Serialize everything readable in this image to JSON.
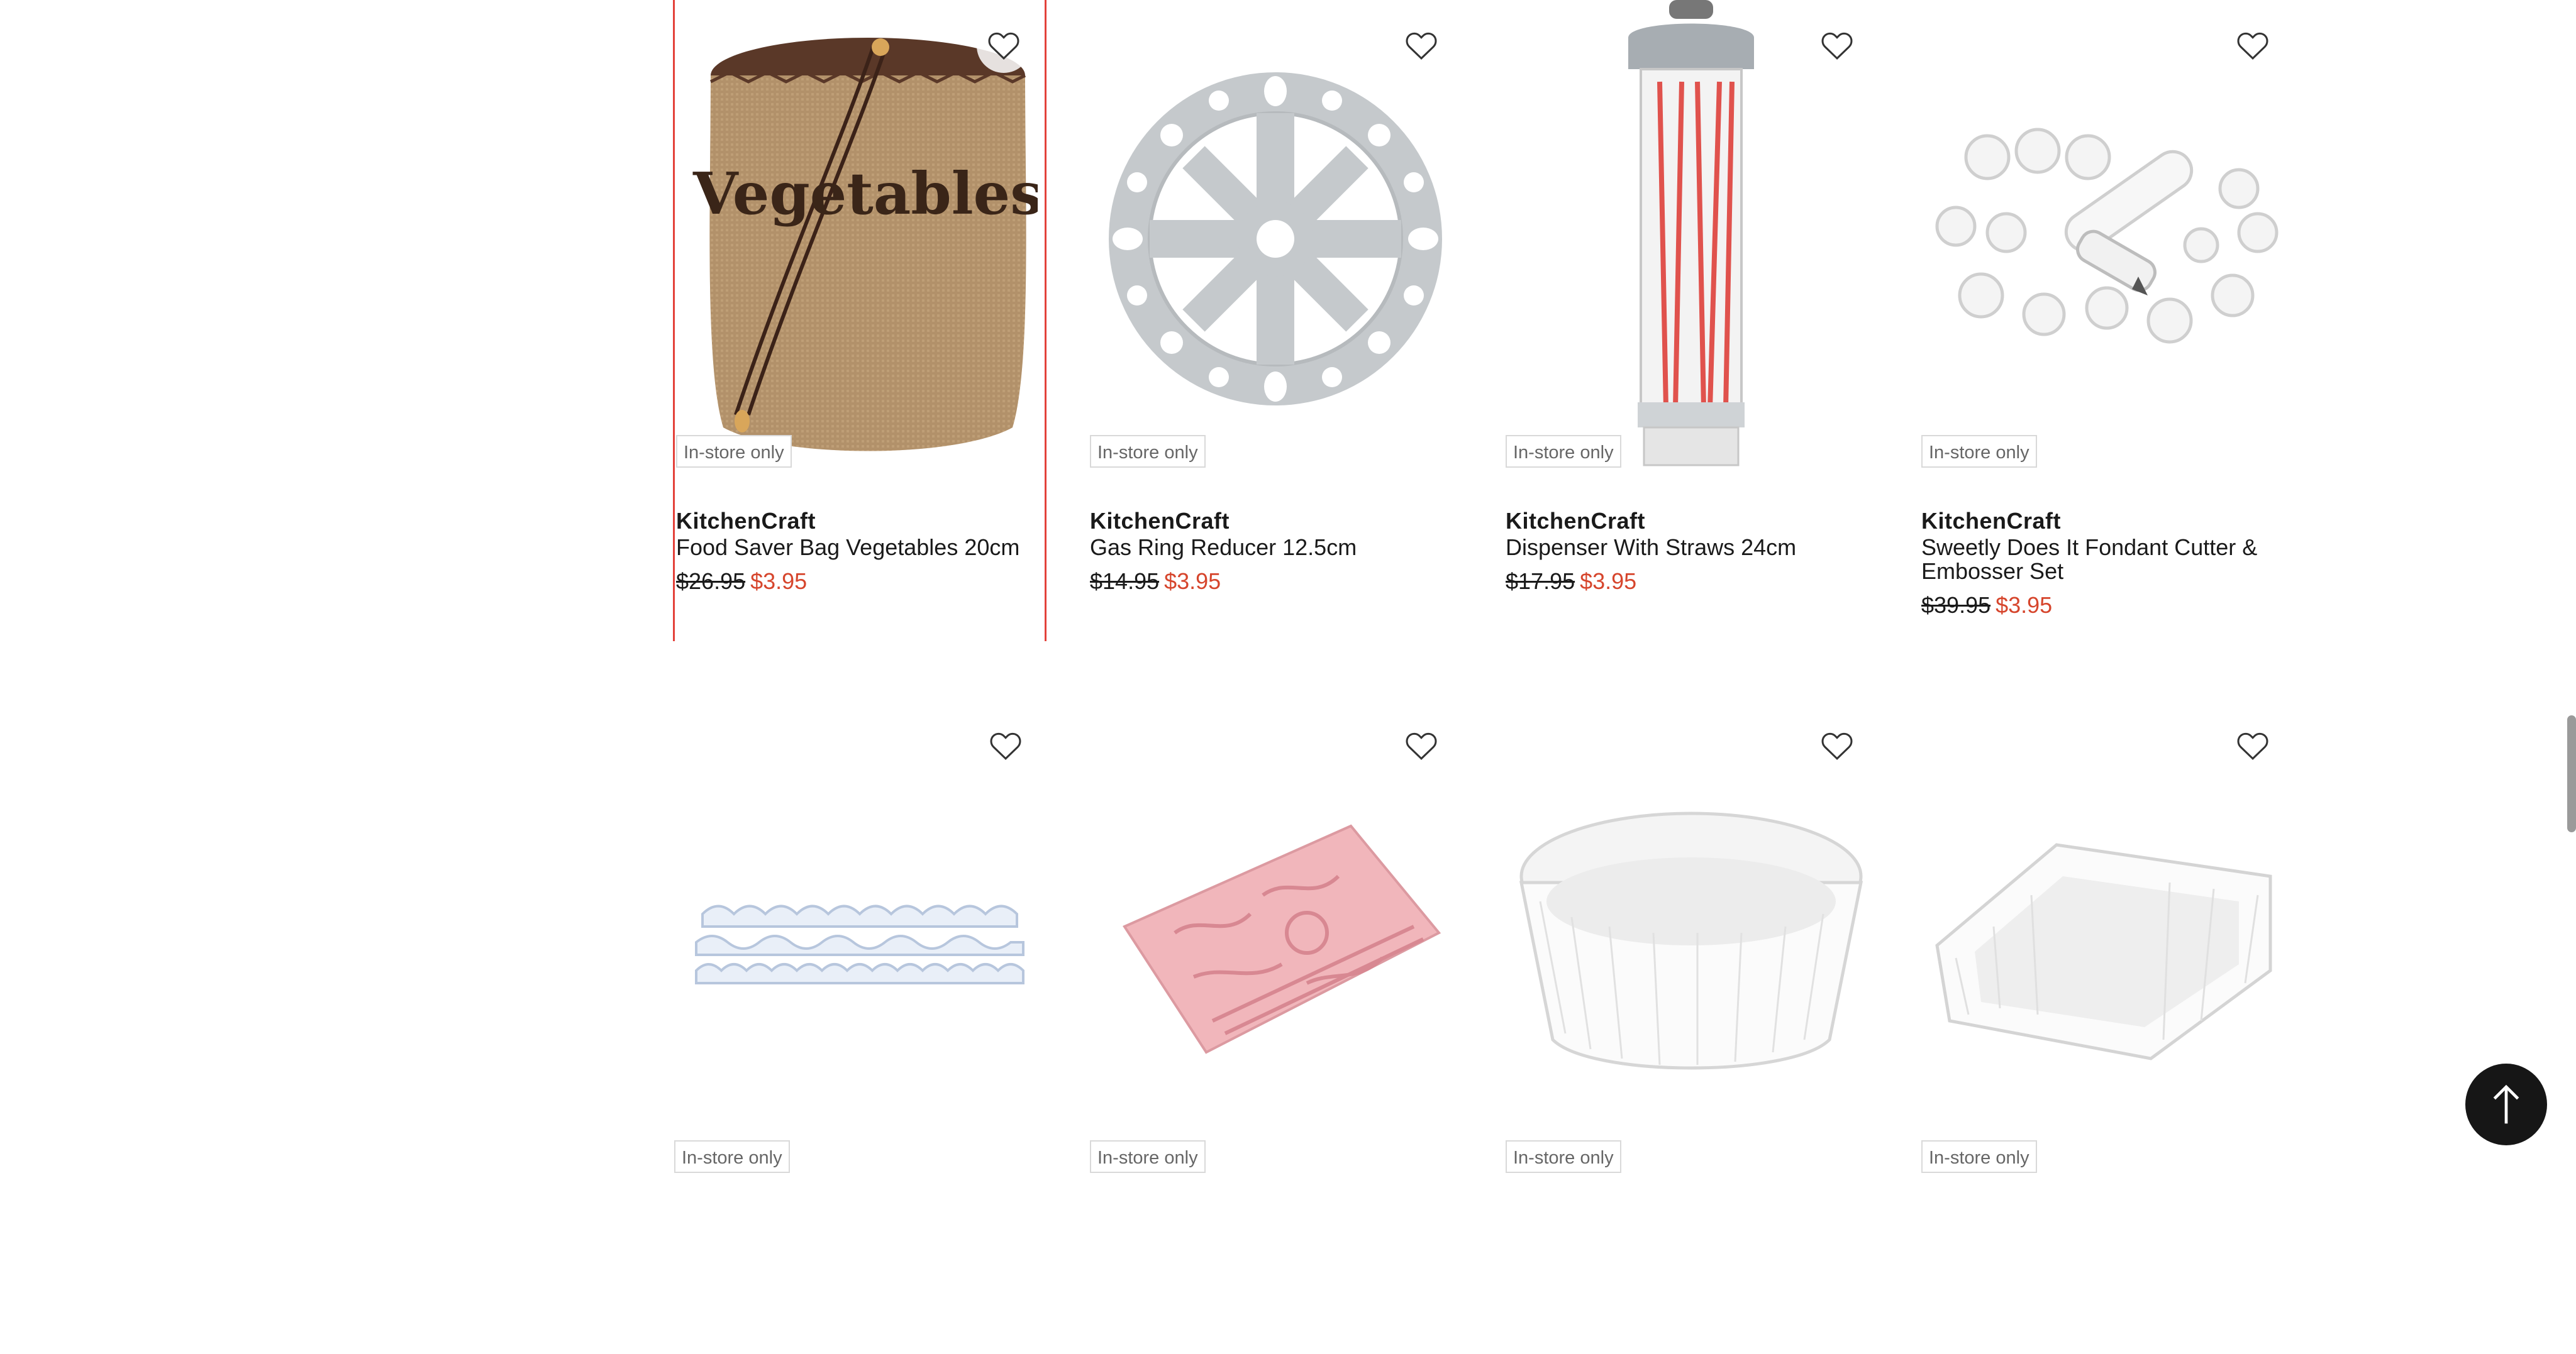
{
  "badge_text": "In-store only",
  "colors": {
    "sale": "#d6452c",
    "selected_border": "#e3413a"
  },
  "row1": [
    {
      "brand": "KitchenCraft",
      "name": "Food Saver Bag Vegetables 20cm",
      "was": "$26.95",
      "now": "$3.95",
      "image_text": "Vegetables"
    },
    {
      "brand": "KitchenCraft",
      "name": "Gas Ring Reducer 12.5cm",
      "was": "$14.95",
      "now": "$3.95"
    },
    {
      "brand": "KitchenCraft",
      "name": "Dispenser With Straws 24cm",
      "was": "$17.95",
      "now": "$3.95"
    },
    {
      "brand": "KitchenCraft",
      "name": "Sweetly Does It Fondant Cutter & Embosser Set",
      "was": "$39.95",
      "now": "$3.95"
    }
  ],
  "row2": [
    {
      "badge": "In-store only"
    },
    {
      "badge": "In-store only"
    },
    {
      "badge": "In-store only"
    },
    {
      "badge": "In-store only"
    }
  ],
  "icons": {
    "favorite": "heart-outline-icon",
    "back_to_top": "arrow-up-icon"
  }
}
